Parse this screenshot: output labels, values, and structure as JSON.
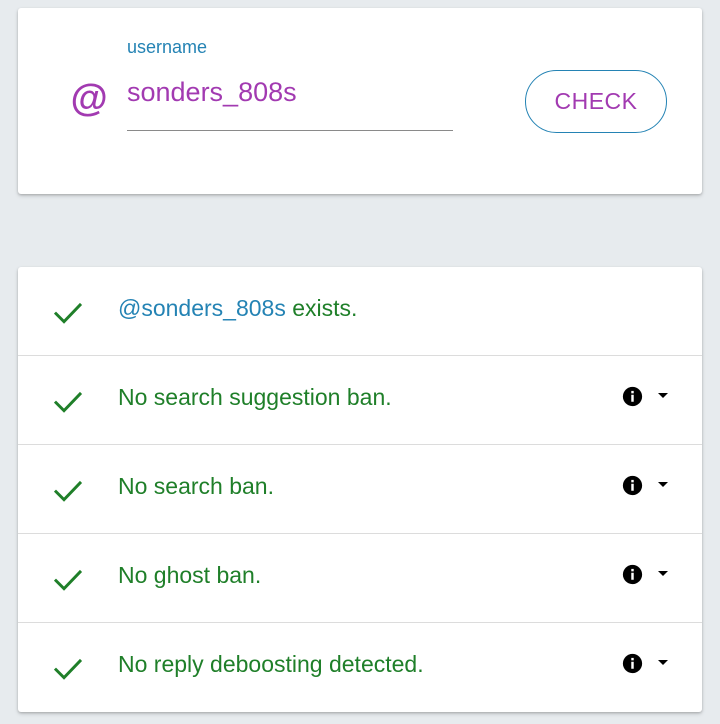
{
  "search": {
    "label": "username",
    "value": "sonders_808s",
    "at_symbol": "@",
    "button_label": "CHECK"
  },
  "results": {
    "exists": {
      "handle": "@sonders_808s",
      "suffix": " exists."
    },
    "items": [
      {
        "label": "No search suggestion ban."
      },
      {
        "label": "No search ban."
      },
      {
        "label": "No ghost ban."
      },
      {
        "label": "No reply deboosting detected."
      }
    ]
  },
  "colors": {
    "accent_purple": "#a23ab1",
    "accent_blue": "#2483b4",
    "success_green": "#1f7f29",
    "background": "#e7ebee"
  },
  "icons": {
    "check": "check-icon",
    "info": "info-icon",
    "caret": "caret-down-icon"
  }
}
